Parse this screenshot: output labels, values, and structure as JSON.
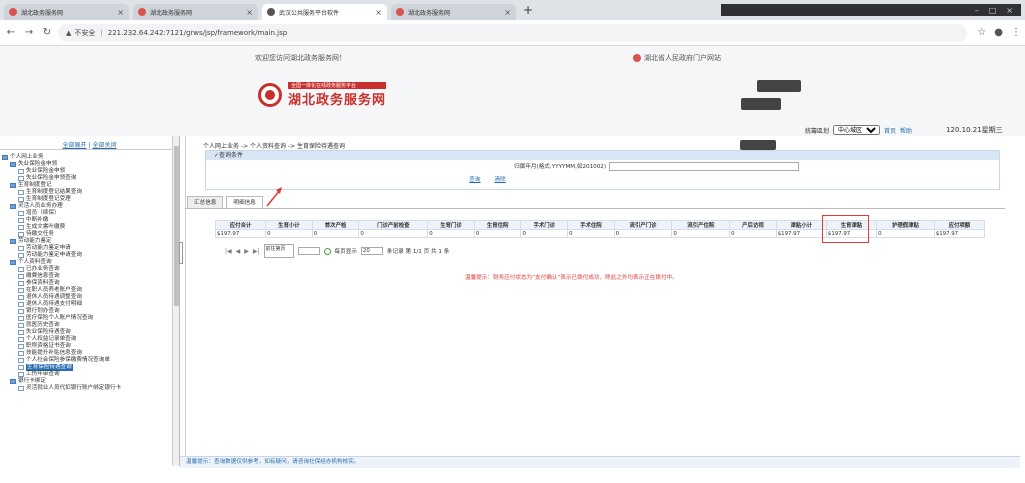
{
  "browser": {
    "tabs": [
      {
        "title": "湖北政务服务网",
        "active": false
      },
      {
        "title": "湖北政务服务网",
        "active": false
      },
      {
        "title": "武汉公共服务平台软件",
        "active": true
      },
      {
        "title": "湖北政务服务网",
        "active": false
      }
    ],
    "new_tab": "+",
    "security_label": "不安全",
    "url": "221.232.64.242:7121/grws/jsp/framework/main.jsp"
  },
  "header": {
    "welcome": "欢迎您访问湖北政务服务网！",
    "gov_portal_link": "湖北省人民政府门户网站",
    "logo_subtitle": "全国一体化在线政务服务平台",
    "logo_title": "湖北政务服务网",
    "region_label": "統籌區划",
    "region_select": "中心城区",
    "home_link": "首页",
    "help_link": "帮助",
    "date": "120.10.21星期三"
  },
  "sidebar": {
    "expand_all": "全部展开",
    "divider": "|",
    "collapse_all": "全部关闭",
    "items": [
      {
        "label": "个人网上业务",
        "level": 0,
        "type": "folder"
      },
      {
        "label": "失业保险金申领",
        "level": 1,
        "type": "folder"
      },
      {
        "label": "失业保险金申领",
        "level": 2,
        "type": "page"
      },
      {
        "label": "失业保险金申领查询",
        "level": 2,
        "type": "page"
      },
      {
        "label": "生育制度登记",
        "level": 1,
        "type": "folder"
      },
      {
        "label": "生育制度登记结果查询",
        "level": 2,
        "type": "page"
      },
      {
        "label": "生育制度登记受理",
        "level": 2,
        "type": "page"
      },
      {
        "label": "灵活人员业务办理",
        "level": 1,
        "type": "folder"
      },
      {
        "label": "增员（续保）",
        "level": 2,
        "type": "page"
      },
      {
        "label": "中断补缴",
        "level": 2,
        "type": "page"
      },
      {
        "label": "生成文書叶缴费",
        "level": 2,
        "type": "page"
      },
      {
        "label": "待缴交任务",
        "level": 2,
        "type": "page"
      },
      {
        "label": "劳动能力鉴定",
        "level": 1,
        "type": "folder"
      },
      {
        "label": "劳动能力鉴定申请",
        "level": 2,
        "type": "page"
      },
      {
        "label": "劳动能力鉴定申请查询",
        "level": 2,
        "type": "page"
      },
      {
        "label": "个人资料查询",
        "level": 1,
        "type": "folder"
      },
      {
        "label": "已办业务查询",
        "level": 2,
        "type": "page"
      },
      {
        "label": "缴費信息查询",
        "level": 2,
        "type": "page"
      },
      {
        "label": "参保资料查询",
        "level": 2,
        "type": "page"
      },
      {
        "label": "在职人员养老账户查询",
        "level": 2,
        "type": "page"
      },
      {
        "label": "退休人员待遇调整查询",
        "level": 2,
        "type": "page"
      },
      {
        "label": "退休人员待遇支付明细",
        "level": 2,
        "type": "page"
      },
      {
        "label": "银行划办查询",
        "level": 2,
        "type": "page"
      },
      {
        "label": "医疗保险个人账户情况查询",
        "level": 2,
        "type": "page"
      },
      {
        "label": "就医历史查询",
        "level": 2,
        "type": "page"
      },
      {
        "label": "失业保险待遇查询",
        "level": 2,
        "type": "page"
      },
      {
        "label": "个人权益记录单查询",
        "level": 2,
        "type": "page"
      },
      {
        "label": "职称资格证书查询",
        "level": 2,
        "type": "page"
      },
      {
        "label": "技能提升补贴信息查询",
        "level": 2,
        "type": "page"
      },
      {
        "label": "个人社会保险参保缴费情况查询单",
        "level": 2,
        "type": "page"
      },
      {
        "label": "生育保险待遇查询",
        "level": 2,
        "type": "page",
        "selected": true
      },
      {
        "label": "工伤年审查询",
        "level": 2,
        "type": "page"
      },
      {
        "label": "银行卡绑定",
        "level": 1,
        "type": "folder"
      },
      {
        "label": "灵活就业人员代扣银行账户绑定银行卡",
        "level": 2,
        "type": "page"
      }
    ]
  },
  "main": {
    "breadcrumb": "个人网上业务 -> 个人资料查询 -> 生育保险待遇查询",
    "query_title": "查询条件",
    "query_label": "归属年月(格式:YYYYMM,如201002)",
    "query_value": "",
    "query_button": "查询",
    "reset_button": "清除",
    "tabs": [
      "汇总信息",
      "明细信息"
    ],
    "active_tab": 1,
    "table": {
      "headers": [
        "应付合计",
        "生育小计",
        "首次产检",
        "门诊产前检查",
        "生育门诊",
        "生育住院",
        "手术门诊",
        "手术住院",
        "流引产门诊",
        "流引产住院",
        "产后访视",
        "津贴小计",
        "生育津贴",
        "护理假津贴",
        "应付项额"
      ],
      "rows": [
        [
          "$197.97",
          "0",
          "0",
          "0",
          "0",
          "0",
          "0",
          "0",
          "0",
          "0",
          "0",
          "$197.97",
          "$197.97",
          "0",
          "$197.97"
        ]
      ]
    },
    "pager": {
      "jump_label": "前往第页",
      "per_page_label": "每页显示",
      "per_page": "20",
      "summary": "条记录 第 1/1 页 共 1 条"
    },
    "notice": "温馨提示：财务应付状态为“支付确认”表示已拨付成功，除此之外均表示正在拨付中。"
  },
  "status_bar": "温馨提示：查询数据仅供参考，如有疑问，请咨询社保经办机构核实。"
}
